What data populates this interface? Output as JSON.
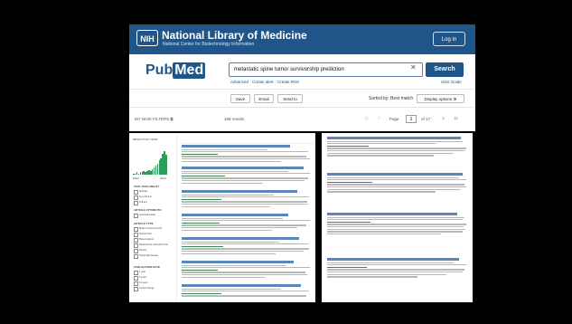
{
  "header": {
    "nih_logo": "NIH",
    "title": "National Library of Medicine",
    "subtitle": "National Center for Biotechnology Information",
    "login_label": "Log in"
  },
  "search": {
    "logo_pub": "Pub",
    "logo_med": "Med",
    "query": "metastatic spine tumor survivorship prediction",
    "button_label": "Search",
    "advanced": "Advanced",
    "create_alert": "Create alert",
    "create_rss": "Create RSS",
    "user_guide": "User Guide"
  },
  "toolbar": {
    "save": "Save",
    "email": "Email",
    "send_to": "Send to",
    "sorted_by": "Sorted by: Best match",
    "display_options": "Display options"
  },
  "results_bar": {
    "my_ncbi_filters": "MY NCBI FILTERS",
    "results_count": "168 results",
    "page_label": "Page",
    "page_number": "1",
    "of_pages": "of 17"
  },
  "filter_sidebar": {
    "timeline_label": "RESULTS BY YEAR",
    "years": [
      "1994",
      "2023"
    ],
    "histogram": [
      1,
      1,
      2,
      1,
      2,
      2,
      3,
      2,
      3,
      4,
      3,
      5,
      6,
      8,
      9,
      12,
      14,
      18,
      20,
      17
    ],
    "sections": [
      {
        "heading": "TEXT AVAILABILITY",
        "items": [
          "Abstract",
          "Free full text",
          "Full text"
        ]
      },
      {
        "heading": "ARTICLE ATTRIBUTE",
        "items": [
          "Associated data"
        ]
      },
      {
        "heading": "ARTICLE TYPE",
        "items": [
          "Books and Documents",
          "Clinical Trial",
          "Meta-Analysis",
          "Randomized Controlled Trial",
          "Review",
          "Systematic Review"
        ]
      },
      {
        "heading": "PUBLICATION DATE",
        "items": [
          "1 year",
          "5 years",
          "10 years",
          "Custom Range"
        ]
      }
    ]
  }
}
